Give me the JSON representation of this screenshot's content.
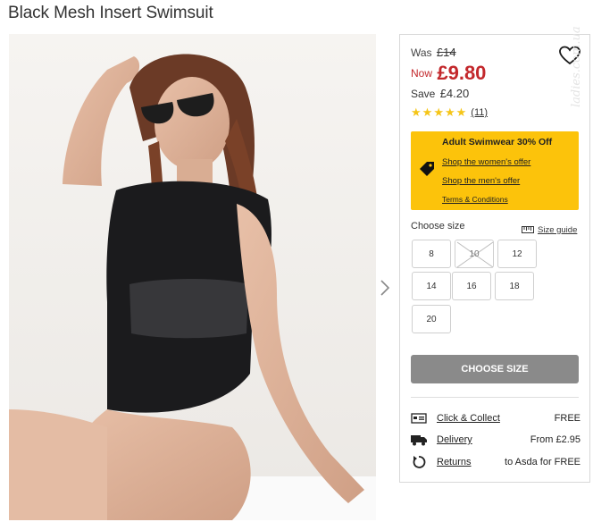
{
  "product": {
    "title": "Black Mesh Insert Swimsuit"
  },
  "price": {
    "was_label": "Was",
    "was_value": "£14",
    "now_label": "Now",
    "now_value": "£9.80",
    "save_label": "Save",
    "save_value": "£4.20"
  },
  "rating": {
    "stars": 5,
    "review_count": "(11)"
  },
  "promo": {
    "title": "Adult Swimwear 30% Off",
    "link_women": "Shop the women's offer",
    "link_men": "Shop the men's offer",
    "link_terms": "Terms & Conditions"
  },
  "sizes": {
    "label": "Choose size",
    "guide_label": "Size guide",
    "options": [
      "8",
      "10",
      "12",
      "14",
      "16",
      "18",
      "20"
    ],
    "unavailable": [
      "10"
    ]
  },
  "cta": {
    "label": "CHOOSE SIZE"
  },
  "delivery": {
    "click_collect_label": "Click & Collect",
    "click_collect_value": "FREE",
    "delivery_label": "Delivery",
    "delivery_value": "From £2.95",
    "returns_label": "Returns",
    "returns_value": "to Asda for FREE"
  },
  "icons": {
    "heart": "heart-icon",
    "tag": "tag-icon",
    "ruler": "ruler-icon",
    "store": "store-icon",
    "truck": "truck-icon",
    "returns": "returns-icon",
    "next": "chevron-right-icon"
  },
  "colors": {
    "price_red": "#c3282c",
    "promo_yellow": "#fcc30b",
    "star_gold": "#f5c518",
    "cta_grey": "#8a8a8a"
  },
  "watermark": "ladies.com.ua"
}
